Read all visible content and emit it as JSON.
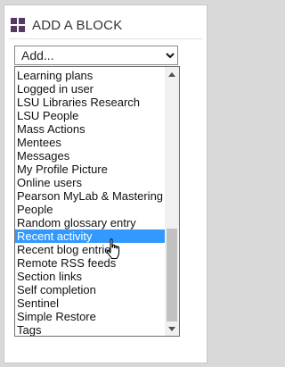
{
  "block": {
    "title": "ADD A BLOCK",
    "icon": "block-grid-icon",
    "accent_color": "#573963"
  },
  "select": {
    "value": "Add...",
    "arrow_icon": "chevron-down-icon"
  },
  "dropdown": {
    "selected_color": "#3399ff",
    "items": [
      {
        "label": "Learning plans"
      },
      {
        "label": "Logged in user"
      },
      {
        "label": "LSU Libraries Research"
      },
      {
        "label": "LSU People"
      },
      {
        "label": "Mass Actions"
      },
      {
        "label": "Mentees"
      },
      {
        "label": "Messages"
      },
      {
        "label": "My Profile Picture"
      },
      {
        "label": "Online users"
      },
      {
        "label": "Pearson MyLab & Mastering"
      },
      {
        "label": "People"
      },
      {
        "label": "Random glossary entry"
      },
      {
        "label": "Recent activity",
        "selected": true
      },
      {
        "label": "Recent blog entries"
      },
      {
        "label": "Remote RSS feeds"
      },
      {
        "label": "Section links"
      },
      {
        "label": "Self completion"
      },
      {
        "label": "Sentinel"
      },
      {
        "label": "Simple Restore"
      },
      {
        "label": "Tags"
      }
    ]
  },
  "cursor": {
    "icon": "hand-pointer-icon"
  }
}
